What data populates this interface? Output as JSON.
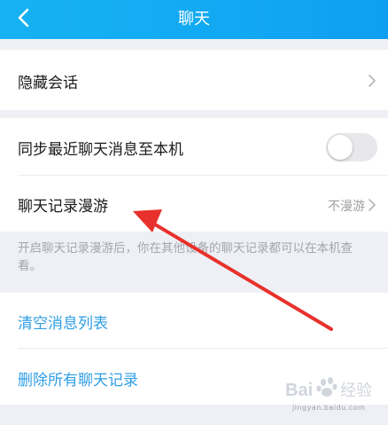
{
  "header": {
    "title": "聊天"
  },
  "rows": {
    "hide_sessions": "隐藏会话",
    "sync_recent": "同步最近聊天消息至本机",
    "roaming": "聊天记录漫游",
    "roaming_value": "不漫游"
  },
  "hint": "开启聊天记录漫游后，你在其他设备的聊天记录都可以在本机查看。",
  "actions": {
    "clear_list": "清空消息列表",
    "delete_all": "删除所有聊天记录"
  },
  "toggle": {
    "sync_recent_on": false
  },
  "watermark": {
    "brand": "Bai",
    "brand2": "经验",
    "url": "jingyan.baidu.com"
  },
  "colors": {
    "header": "#12a8f3",
    "action_text": "#2f9ee6",
    "arrow": "#e8312c"
  }
}
